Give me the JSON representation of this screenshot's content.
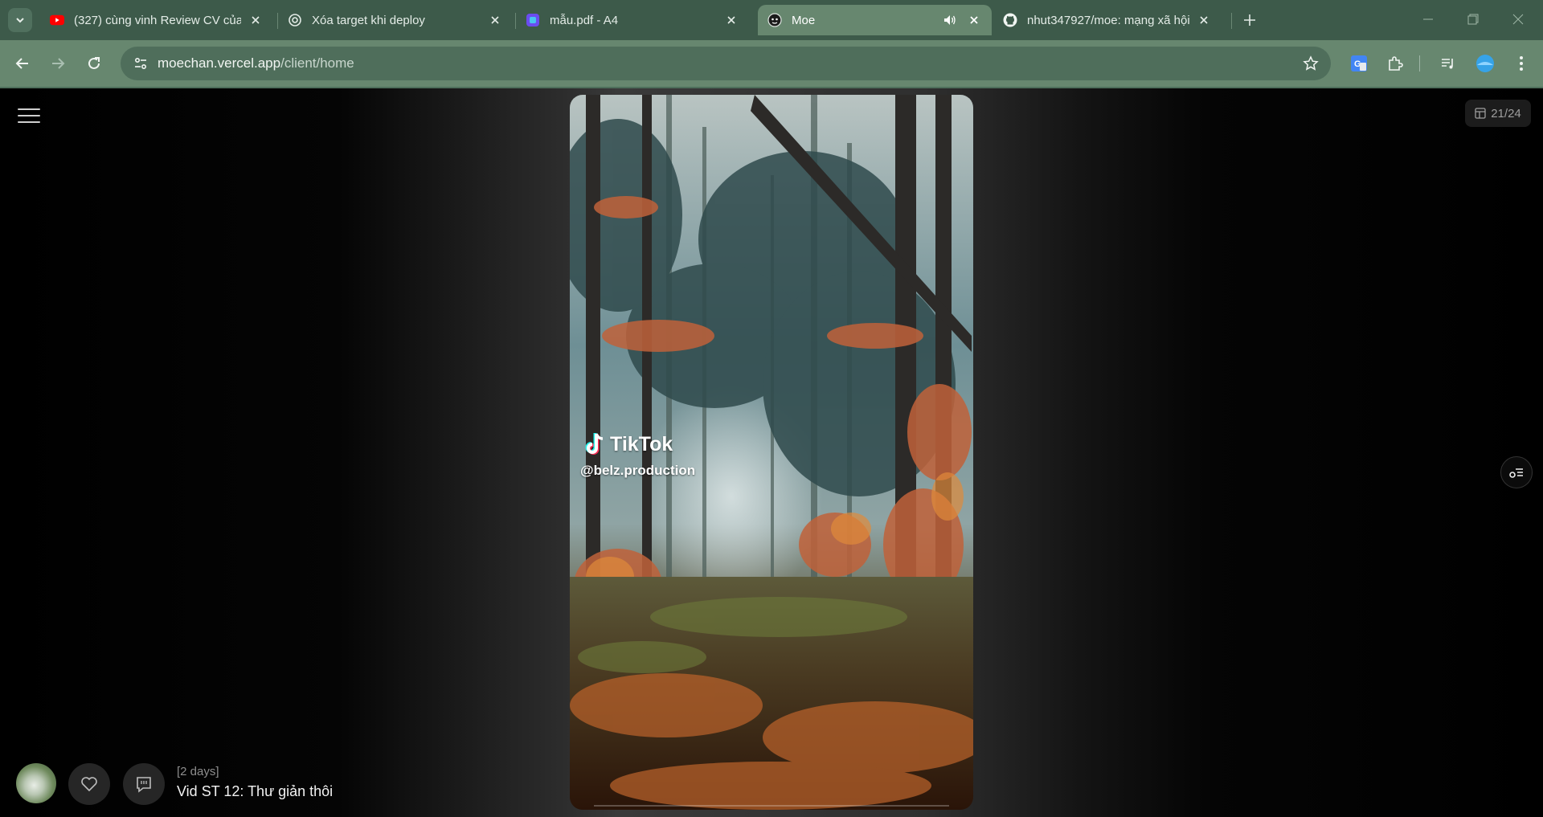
{
  "browser": {
    "tabs": [
      {
        "title": "(327) cùng vinh Review CV của ",
        "icon": "youtube-icon",
        "active": false
      },
      {
        "title": "Xóa target khi deploy",
        "icon": "openai-icon",
        "active": false
      },
      {
        "title": "mẫu.pdf - A4",
        "icon": "pdf-app-icon",
        "active": false
      },
      {
        "title": "Moe",
        "icon": "moe-face-icon",
        "active": true,
        "audio": true
      },
      {
        "title": "nhut347927/moe: mạng xã hội",
        "icon": "github-icon",
        "active": false
      }
    ],
    "url_host": "moechan.vercel.app",
    "url_path": "/client/home"
  },
  "page": {
    "counter": "21/24",
    "video": {
      "watermark_brand": "TikTok",
      "watermark_handle": "@belz.production"
    },
    "post": {
      "time": "[2 days]",
      "title": "Vid ST 12: Thư giản thôi"
    }
  },
  "colors": {
    "chrome_tabbar": "#3d5a4a",
    "chrome_toolbar": "#67876f",
    "omnibox": "#4f6e5b",
    "page_bg": "#000000"
  }
}
